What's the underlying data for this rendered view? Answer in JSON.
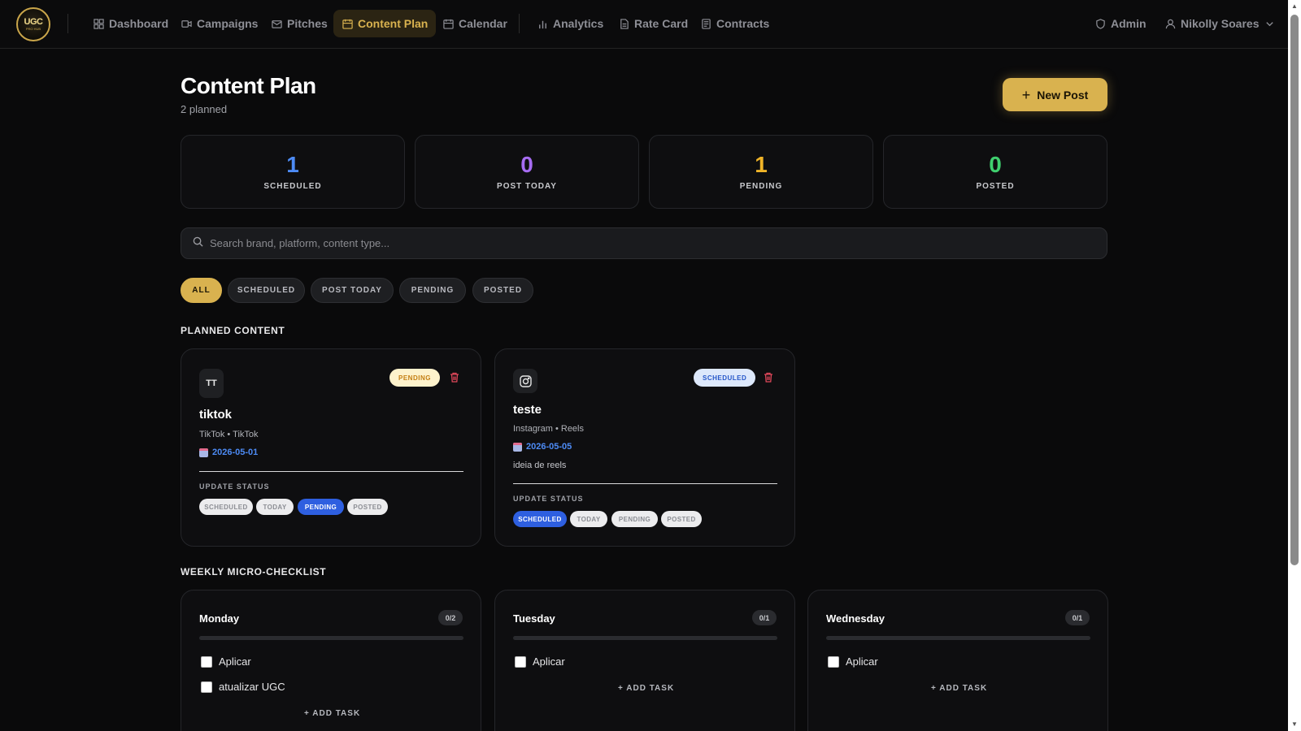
{
  "brand": {
    "logo_text": "UGC",
    "logo_sub": "PRO HUB",
    "accent": "#d9b24f"
  },
  "nav": {
    "items": [
      {
        "label": "Dashboard",
        "icon": "grid-icon"
      },
      {
        "label": "Campaigns",
        "icon": "video-icon"
      },
      {
        "label": "Pitches",
        "icon": "mail-icon"
      },
      {
        "label": "Content Plan",
        "icon": "calendar-icon",
        "active": true
      },
      {
        "label": "Calendar",
        "icon": "calendar-icon"
      },
      {
        "label": "Analytics",
        "icon": "bar-chart-icon"
      },
      {
        "label": "Rate Card",
        "icon": "document-icon"
      },
      {
        "label": "Contracts",
        "icon": "contract-icon"
      }
    ],
    "admin": "Admin",
    "user": "Nikolly Soares"
  },
  "header": {
    "title": "Content Plan",
    "subtitle": "2 planned",
    "new_post": "New Post"
  },
  "stats": [
    {
      "value": "1",
      "label": "SCHEDULED",
      "color": "#4d8bf5"
    },
    {
      "value": "0",
      "label": "POST TODAY",
      "color": "#a66cf2"
    },
    {
      "value": "1",
      "label": "PENDING",
      "color": "#f0b428"
    },
    {
      "value": "0",
      "label": "POSTED",
      "color": "#3fcf6e"
    }
  ],
  "search": {
    "placeholder": "Search brand, platform, content type..."
  },
  "filters": [
    "ALL",
    "SCHEDULED",
    "POST TODAY",
    "PENDING",
    "POSTED"
  ],
  "planned": {
    "title": "PLANNED CONTENT",
    "update_label": "UPDATE STATUS",
    "status_options": [
      "SCHEDULED",
      "TODAY",
      "PENDING",
      "POSTED"
    ],
    "posts": [
      {
        "platform_icon": "TT",
        "status": "PENDING",
        "title": "tiktok",
        "meta": "TikTok • TikTok",
        "date": "2026-05-01",
        "notes": "",
        "selected": "PENDING"
      },
      {
        "platform_icon": "instagram-icon",
        "status": "SCHEDULED",
        "title": "teste",
        "meta": "Instagram • Reels",
        "date": "2026-05-05",
        "notes": "ideia de reels",
        "selected": "SCHEDULED"
      }
    ]
  },
  "checklist": {
    "title": "WEEKLY MICRO-CHECKLIST",
    "add_task": "+ ADD TASK",
    "days": [
      {
        "name": "Monday",
        "count": "0/2",
        "done": 0,
        "total": 2,
        "tasks": [
          "Aplicar",
          "atualizar UGC"
        ]
      },
      {
        "name": "Tuesday",
        "count": "0/1",
        "done": 0,
        "total": 1,
        "tasks": [
          "Aplicar"
        ]
      },
      {
        "name": "Wednesday",
        "count": "0/1",
        "done": 0,
        "total": 1,
        "tasks": [
          "Aplicar"
        ]
      }
    ]
  }
}
